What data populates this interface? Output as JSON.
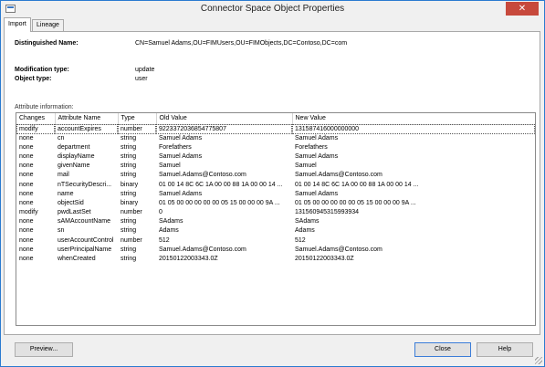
{
  "window": {
    "title": "Connector Space Object Properties",
    "close_glyph": "✕"
  },
  "tabs": [
    {
      "label": "Import"
    },
    {
      "label": "Lineage"
    }
  ],
  "summary": {
    "dn_label": "Distinguished Name:",
    "dn_value": "CN=Samuel Adams,OU=FIMUsers,OU=FIMObjects,DC=Contoso,DC=com",
    "mod_label": "Modification type:",
    "mod_value": "update",
    "obj_label": "Object type:",
    "obj_value": "user"
  },
  "attributes": {
    "section_label": "Attribute information:",
    "columns": [
      "Changes",
      "Attribute Name",
      "Type",
      "Old Value",
      "New Value"
    ],
    "rows": [
      [
        "modify",
        "accountExpires",
        "number",
        "9223372036854775807",
        "131587416000000000"
      ],
      [
        "none",
        "cn",
        "string",
        "Samuel Adams",
        "Samuel Adams"
      ],
      [
        "none",
        "department",
        "string",
        "Forefathers",
        "Forefathers"
      ],
      [
        "none",
        "displayName",
        "string",
        "Samuel Adams",
        "Samuel Adams"
      ],
      [
        "none",
        "givenName",
        "string",
        "Samuel",
        "Samuel"
      ],
      [
        "none",
        "mail",
        "string",
        "Samuel.Adams@Contoso.com",
        "Samuel.Adams@Contoso.com"
      ],
      [
        "none",
        "nTSecurityDescri...",
        "binary",
        "01 00 14 8C 6C 1A 00 00 88 1A 00 00 14 ...",
        "01 00 14 8C 6C 1A 00 00 88 1A 00 00 14 ..."
      ],
      [
        "none",
        "name",
        "string",
        "Samuel Adams",
        "Samuel Adams"
      ],
      [
        "none",
        "objectSid",
        "binary",
        "01 05 00 00 00 00 00 05 15 00 00 00 9A ...",
        "01 05 00 00 00 00 00 05 15 00 00 00 9A ..."
      ],
      [
        "modify",
        "pwdLastSet",
        "number",
        "0",
        "131560945315993934"
      ],
      [
        "none",
        "sAMAccountName",
        "string",
        "SAdams",
        "SAdams"
      ],
      [
        "none",
        "sn",
        "string",
        "Adams",
        "Adams"
      ],
      [
        "none",
        "userAccountControl",
        "number",
        "512",
        "512"
      ],
      [
        "none",
        "userPrincipalName",
        "string",
        "Samuel.Adams@Contoso.com",
        "Samuel.Adams@Contoso.com"
      ],
      [
        "none",
        "whenCreated",
        "string",
        "20150122003343.0Z",
        "20150122003343.0Z"
      ]
    ]
  },
  "buttons": {
    "preview": "Preview...",
    "close": "Close",
    "help": "Help"
  }
}
